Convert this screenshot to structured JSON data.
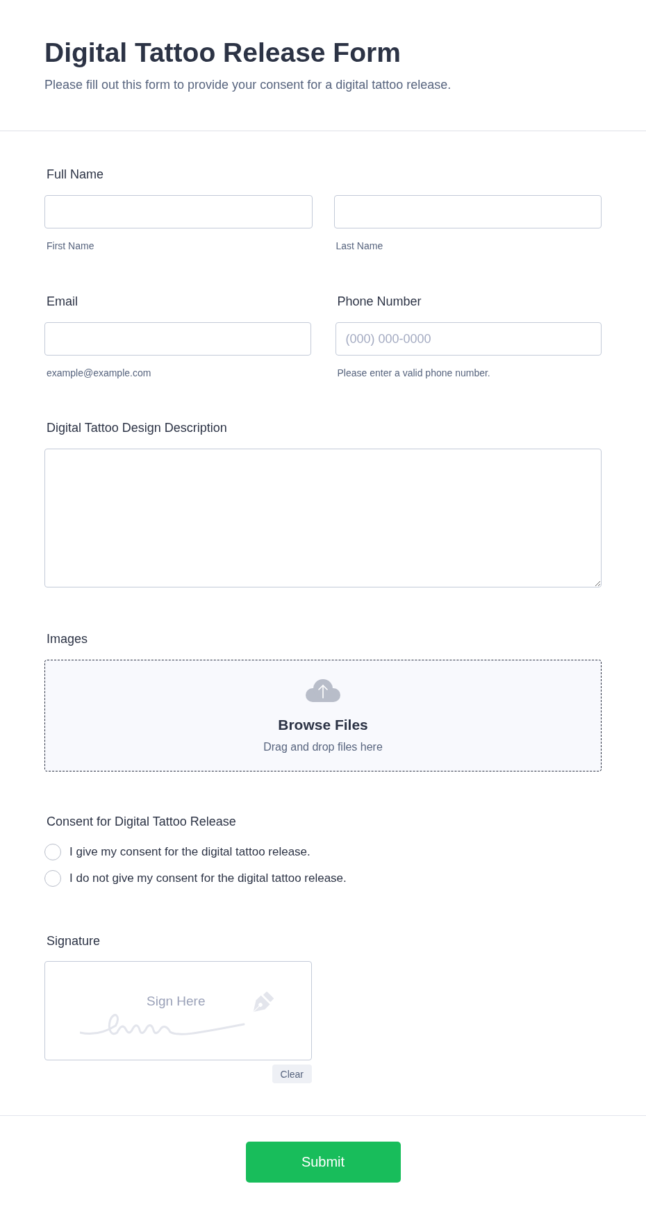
{
  "header": {
    "title": "Digital Tattoo Release Form",
    "subtitle": "Please fill out this form to provide your consent for a digital tattoo release."
  },
  "full_name": {
    "label": "Full Name",
    "parts": [
      {
        "sublabel": "First Name"
      },
      {
        "sublabel": "Last Name"
      }
    ]
  },
  "contact": [
    {
      "label": "Email",
      "sublabel": "example@example.com"
    },
    {
      "label": "Phone Number",
      "placeholder": "(000) 000-0000",
      "sublabel": "Please enter a valid phone number."
    }
  ],
  "description": {
    "label": "Digital Tattoo Design Description"
  },
  "images": {
    "label": "Images",
    "title": "Browse Files",
    "hint": "Drag and drop files here"
  },
  "consent": {
    "label": "Consent for Digital Tattoo Release",
    "options": [
      {
        "label": "I give my consent for the digital tattoo release.",
        "selected": false
      },
      {
        "label": "I do not give my consent for the digital tattoo release.",
        "selected": false
      }
    ]
  },
  "signature": {
    "label": "Signature",
    "placeholder": "Sign Here",
    "clear": "Clear"
  },
  "submit": "Submit"
}
